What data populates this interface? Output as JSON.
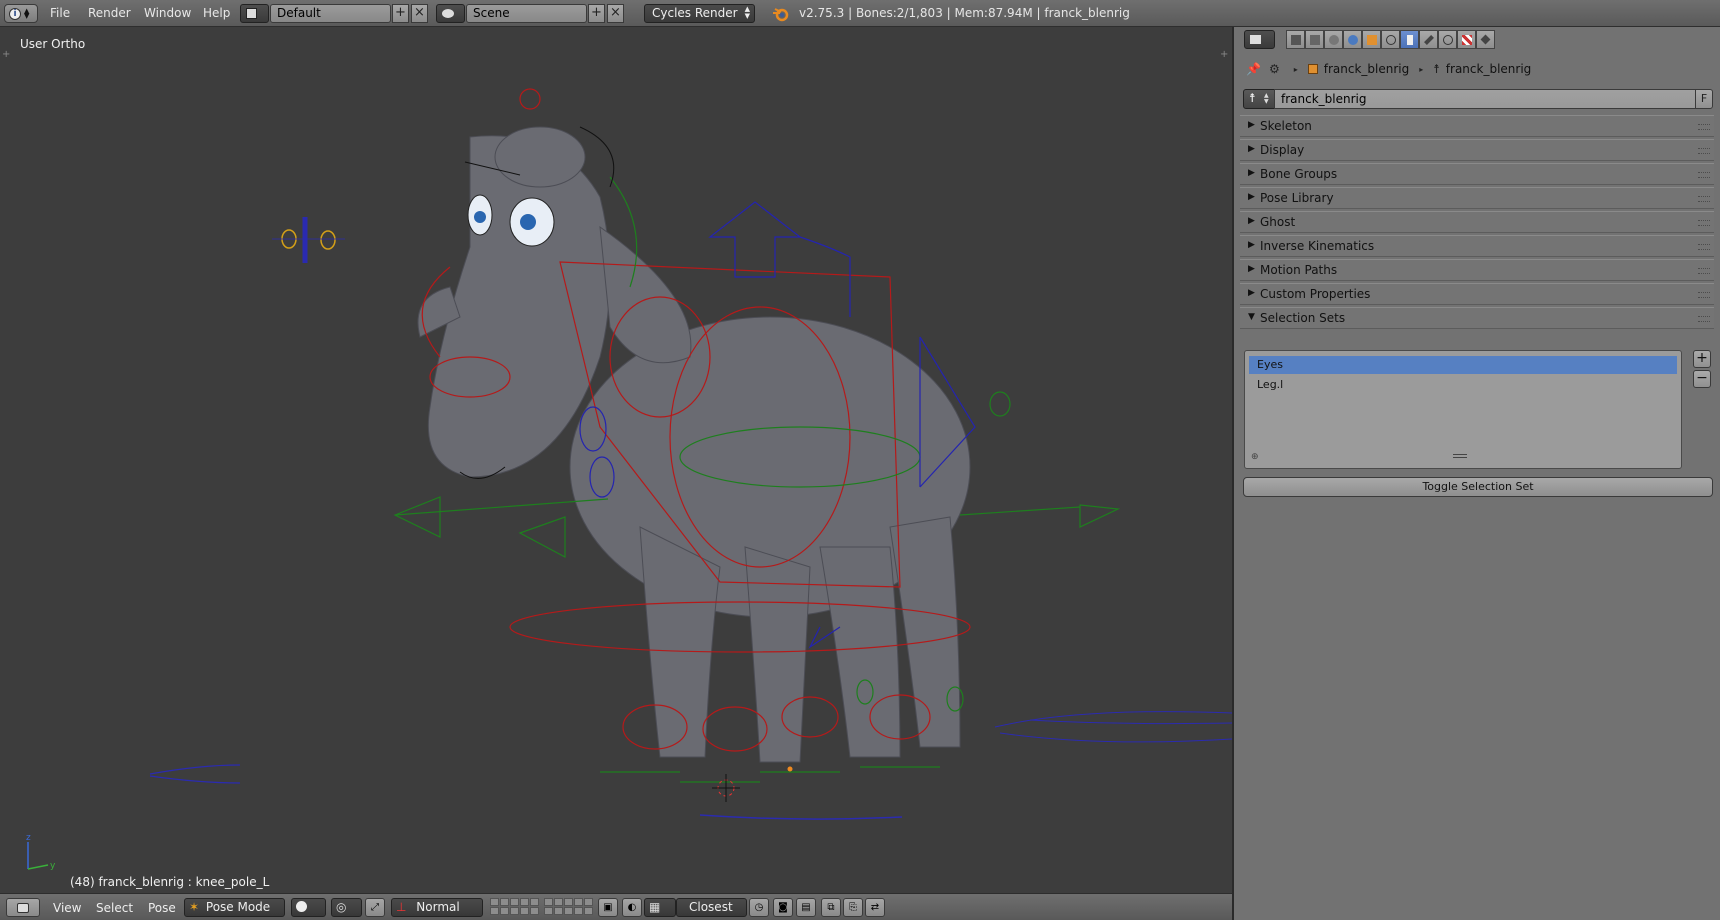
{
  "topbar": {
    "menus": [
      "File",
      "Render",
      "Window",
      "Help"
    ],
    "screen_layout": "Default",
    "scene": "Scene",
    "render_engine": "Cycles Render",
    "stats": "v2.75.3 | Bones:2/1,803  | Mem:87.94M | franck_blenrig"
  },
  "viewport": {
    "view_label": "User Ortho",
    "status": "(48) franck_blenrig : knee_pole_L",
    "axis_labels": {
      "z": "z",
      "y": "y"
    }
  },
  "bottombar": {
    "menus": [
      "View",
      "Select",
      "Pose"
    ],
    "mode": "Pose Mode",
    "pivot_mode": "Normal",
    "snap": "Closest"
  },
  "properties": {
    "breadcrumb_object": "franck_blenrig",
    "breadcrumb_data": "franck_blenrig",
    "armature_name": "franck_blenrig",
    "fake_user_label": "F",
    "panels": [
      {
        "title": "Skeleton",
        "expanded": false
      },
      {
        "title": "Display",
        "expanded": false
      },
      {
        "title": "Bone Groups",
        "expanded": false
      },
      {
        "title": "Pose Library",
        "expanded": false
      },
      {
        "title": "Ghost",
        "expanded": false
      },
      {
        "title": "Inverse Kinematics",
        "expanded": false
      },
      {
        "title": "Motion Paths",
        "expanded": false
      },
      {
        "title": "Custom Properties",
        "expanded": false
      },
      {
        "title": "Selection Sets",
        "expanded": true
      }
    ],
    "selection_sets": [
      "Eyes",
      "Leg.l"
    ],
    "selected_set": "Eyes",
    "add_label": "+",
    "remove_label": "−",
    "toggle_button": "Toggle Selection Set"
  },
  "colors": {
    "accent": "#5680c2",
    "viewport_bg": "#3d3d3d",
    "panel_bg": "#727272",
    "bone_red": "#c01818",
    "bone_green": "#1f8a1f",
    "bone_blue": "#2626b8"
  }
}
